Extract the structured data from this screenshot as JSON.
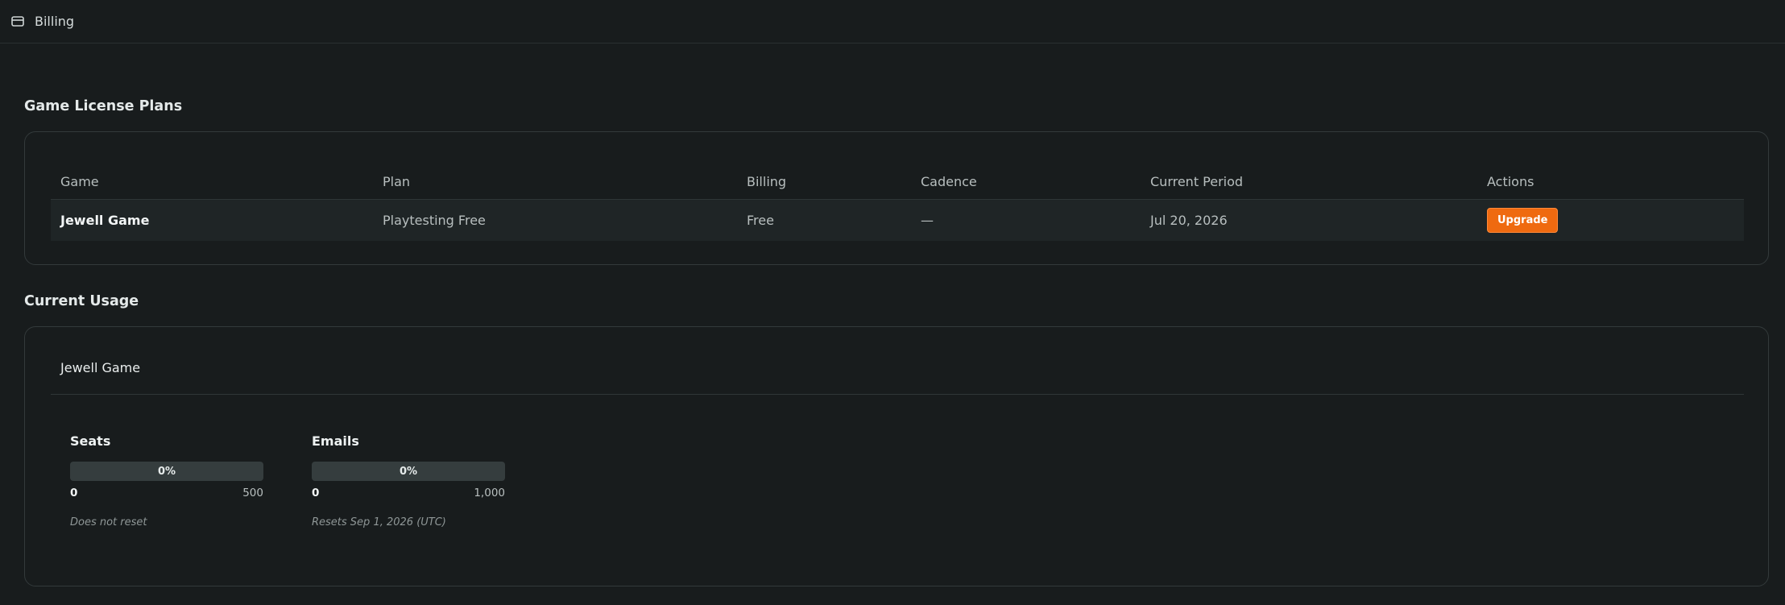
{
  "header": {
    "title": "Billing",
    "icon": "credit-card-icon"
  },
  "plans": {
    "section_title": "Game License Plans",
    "columns": [
      "Game",
      "Plan",
      "Billing",
      "Cadence",
      "Current Period",
      "Actions"
    ],
    "rows": [
      {
        "game": "Jewell Game",
        "plan": "Playtesting Free",
        "billing": "Free",
        "cadence": "—",
        "current_period": "Jul 20, 2026",
        "action_label": "Upgrade"
      }
    ]
  },
  "usage": {
    "section_title": "Current Usage",
    "game": "Jewell Game",
    "metrics": [
      {
        "name": "Seats",
        "percent_label": "0%",
        "fraction": 0,
        "min": "0",
        "max": "500",
        "reset": "Does not reset"
      },
      {
        "name": "Emails",
        "percent_label": "0%",
        "fraction": 0,
        "min": "0",
        "max": "1,000",
        "reset": "Resets Sep 1, 2026 (UTC)"
      }
    ]
  },
  "colors": {
    "accent": "#ef6a10",
    "background": "#181c1d",
    "card_border": "#333a3b"
  }
}
